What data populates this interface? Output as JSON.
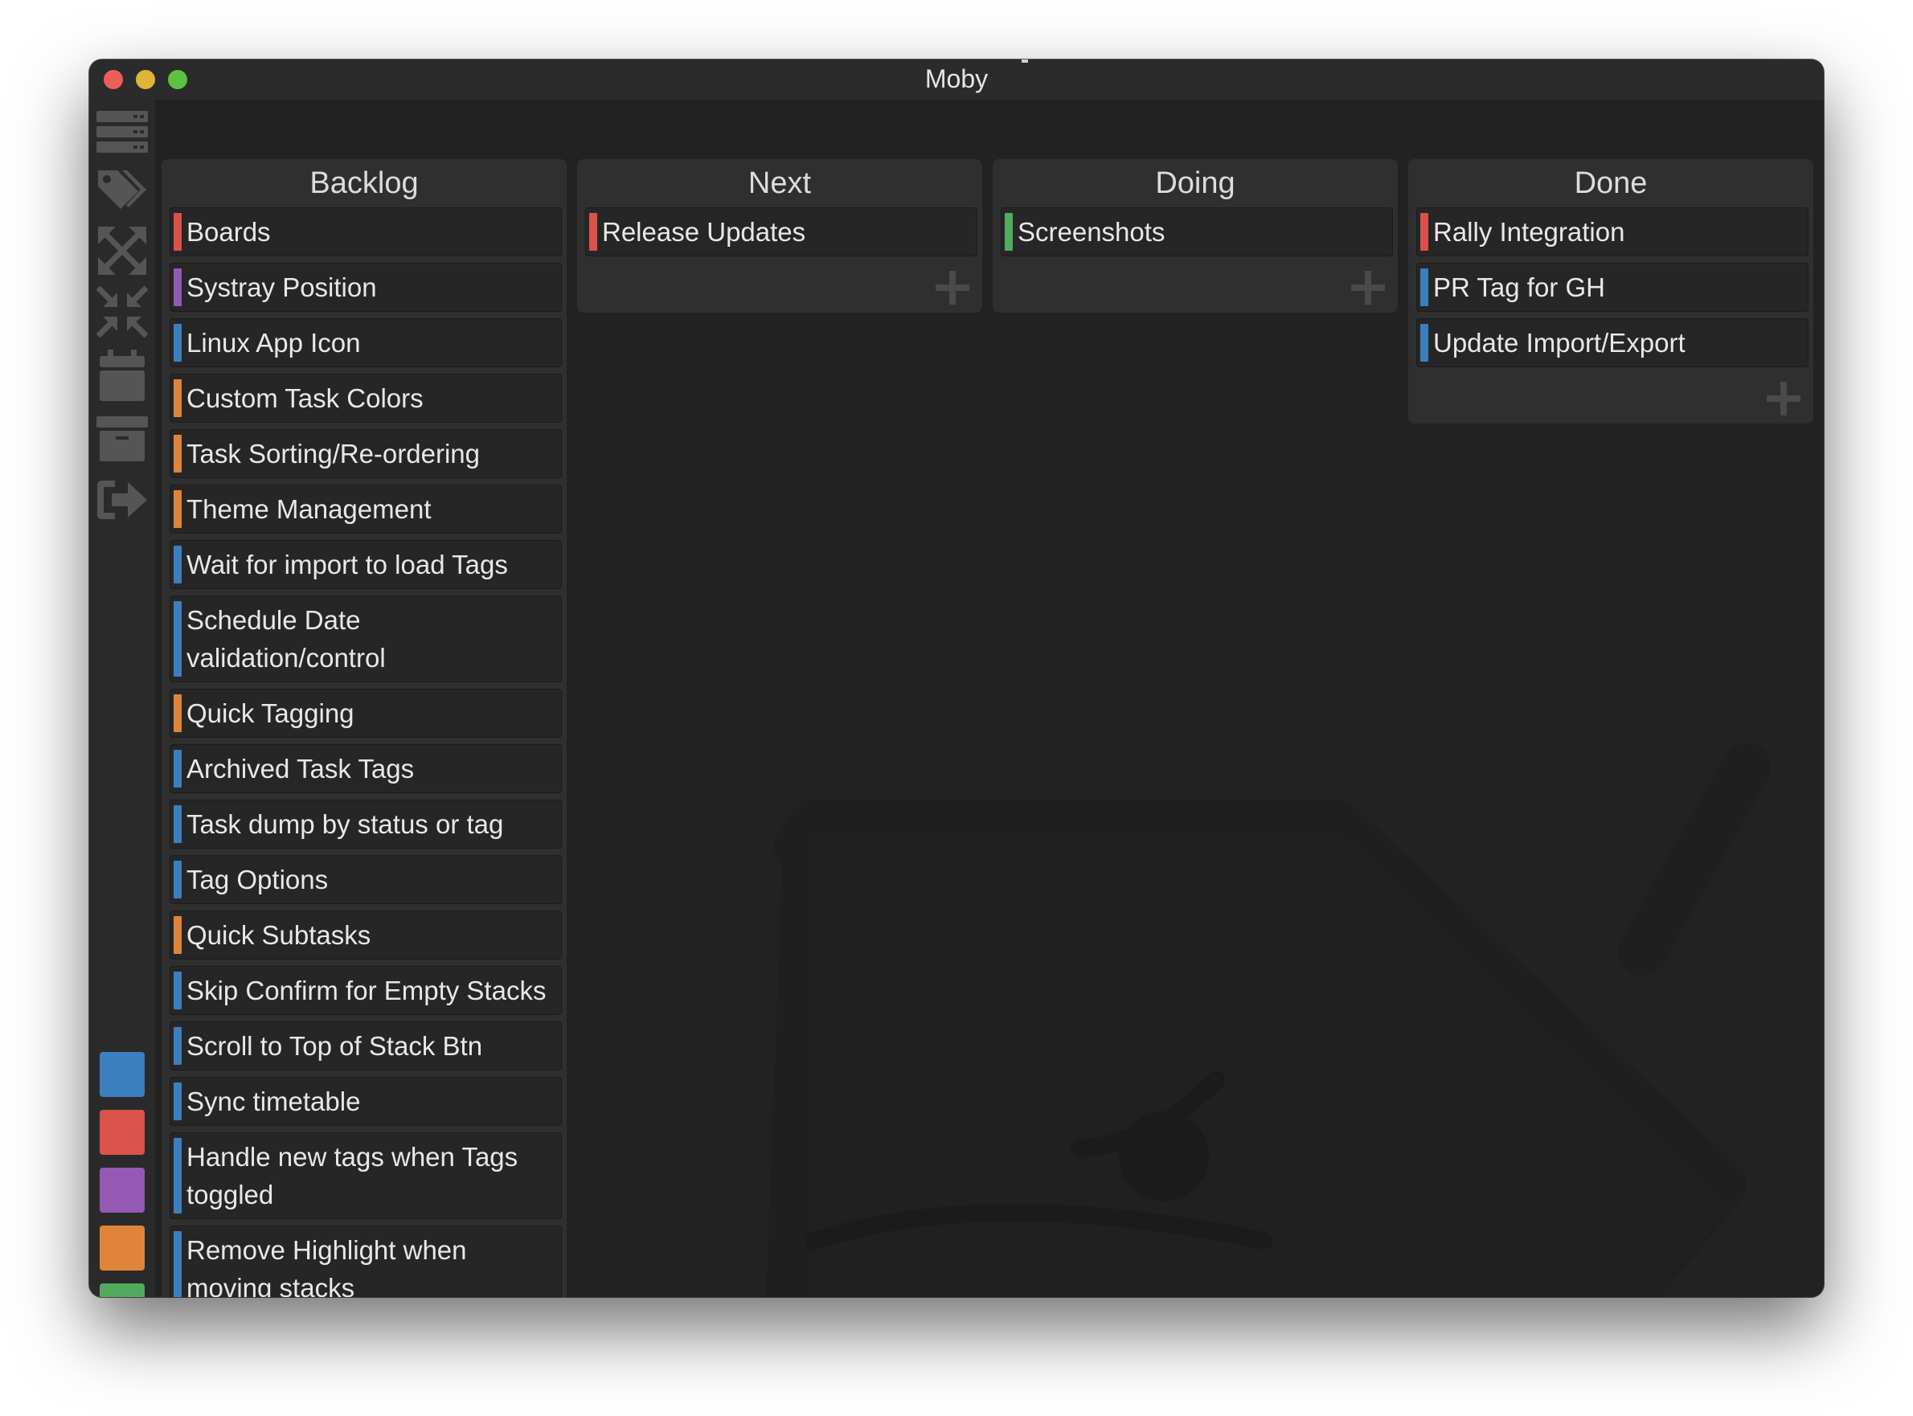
{
  "window": {
    "title": "Moby"
  },
  "sidebar": {
    "icons": [
      {
        "name": "boards-list-icon"
      },
      {
        "name": "tags-icon"
      },
      {
        "name": "expand-icon"
      },
      {
        "name": "collapse-icon"
      },
      {
        "name": "calendar-icon"
      },
      {
        "name": "archive-icon"
      },
      {
        "name": "export-icon"
      }
    ],
    "color_filters": [
      {
        "name": "blue",
        "color": "#3c7fbf"
      },
      {
        "name": "red",
        "color": "#d9534a"
      },
      {
        "name": "purple",
        "color": "#9459b3"
      },
      {
        "name": "orange",
        "color": "#e0843a"
      },
      {
        "name": "green",
        "color": "#52aa5e"
      }
    ]
  },
  "colors": {
    "red": "#d9534a",
    "purple": "#9459b3",
    "blue": "#3c7fbf",
    "orange": "#e0843a",
    "green": "#52aa5e"
  },
  "stacks": [
    {
      "title": "Backlog",
      "tasks": [
        {
          "label": "Boards",
          "color": "#d9534a"
        },
        {
          "label": "Systray Position",
          "color": "#9459b3"
        },
        {
          "label": "Linux App Icon",
          "color": "#3c7fbf"
        },
        {
          "label": "Custom Task Colors",
          "color": "#e0843a"
        },
        {
          "label": "Task Sorting/Re-ordering",
          "color": "#e0843a"
        },
        {
          "label": "Theme Management",
          "color": "#e0843a"
        },
        {
          "label": "Wait for import to load Tags",
          "color": "#3c7fbf"
        },
        {
          "label": "Schedule Date validation/control",
          "color": "#3c7fbf"
        },
        {
          "label": "Quick Tagging",
          "color": "#e0843a"
        },
        {
          "label": "Archived Task Tags",
          "color": "#3c7fbf"
        },
        {
          "label": "Task dump by status or tag",
          "color": "#3c7fbf"
        },
        {
          "label": "Tag Options",
          "color": "#3c7fbf"
        },
        {
          "label": "Quick Subtasks",
          "color": "#e0843a"
        },
        {
          "label": "Skip Confirm for Empty Stacks",
          "color": "#3c7fbf"
        },
        {
          "label": "Scroll to Top of Stack Btn",
          "color": "#3c7fbf"
        },
        {
          "label": "Sync timetable",
          "color": "#3c7fbf"
        },
        {
          "label": "Handle new tags when Tags toggled",
          "color": "#3c7fbf"
        },
        {
          "label": "Remove Highlight when moving stacks",
          "color": "#3c7fbf"
        }
      ]
    },
    {
      "title": "Next",
      "tasks": [
        {
          "label": "Release Updates",
          "color": "#d9534a"
        }
      ]
    },
    {
      "title": "Doing",
      "tasks": [
        {
          "label": "Screenshots",
          "color": "#52aa5e"
        }
      ]
    },
    {
      "title": "Done",
      "tasks": [
        {
          "label": "Rally Integration",
          "color": "#d9534a"
        },
        {
          "label": "PR Tag for GH",
          "color": "#3c7fbf"
        },
        {
          "label": "Update Import/Export",
          "color": "#3c7fbf"
        }
      ]
    }
  ]
}
